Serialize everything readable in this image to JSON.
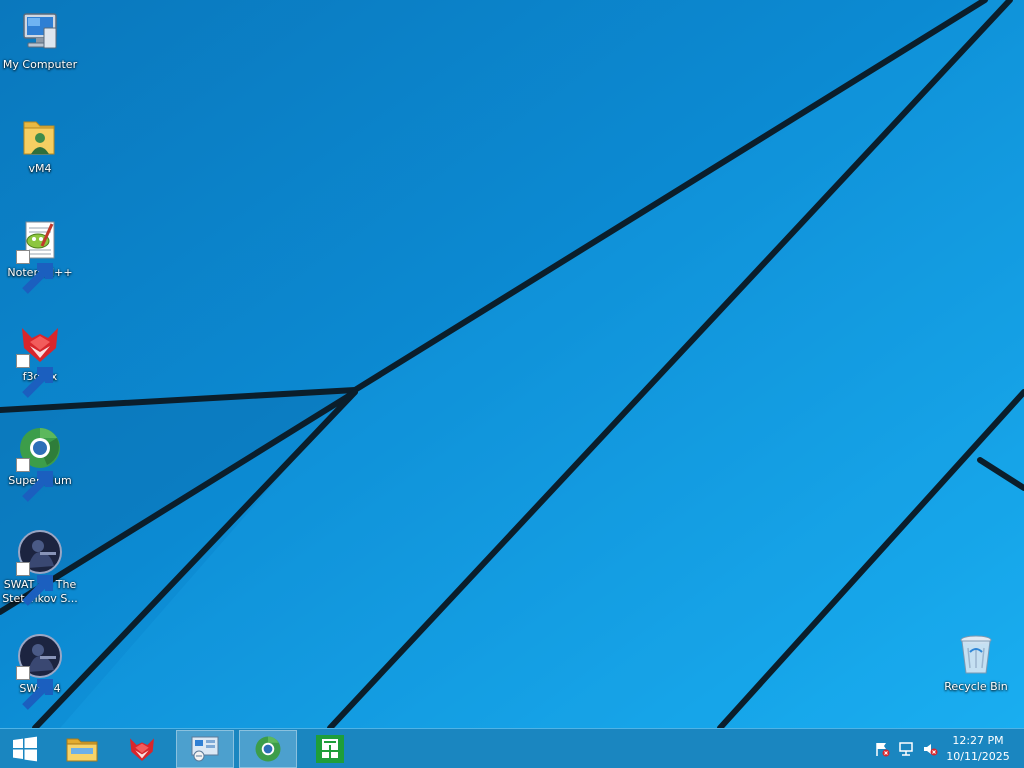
{
  "desktop": {
    "icons": [
      {
        "label": "My Computer",
        "icon": "computer-icon",
        "shortcut": false
      },
      {
        "label": "vM4",
        "icon": "folder-user-icon",
        "shortcut": false
      },
      {
        "label": "Notepad++",
        "icon": "notepadpp-icon",
        "shortcut": true
      },
      {
        "label": "f3dfox",
        "icon": "fox-icon",
        "shortcut": true
      },
      {
        "label": "Supermium",
        "icon": "supermium-icon",
        "shortcut": true
      },
      {
        "label": "SWAT 4 - The Stetchkov S...",
        "icon": "swat4-icon",
        "shortcut": true
      },
      {
        "label": "SWAT 4",
        "icon": "swat4-icon",
        "shortcut": true
      }
    ],
    "recycle_bin": {
      "label": "Recycle Bin",
      "icon": "recycle-bin-icon"
    }
  },
  "taskbar": {
    "start": {
      "icon": "windows-logo-icon"
    },
    "pinned": [
      {
        "icon": "file-explorer-icon",
        "active": false
      },
      {
        "icon": "fox-icon",
        "active": false
      },
      {
        "icon": "control-panel-icon",
        "active": true
      },
      {
        "icon": "supermium-icon",
        "active": true
      },
      {
        "icon": "store-icon",
        "active": false
      }
    ],
    "tray": [
      {
        "icon": "action-center-flag-icon"
      },
      {
        "icon": "network-icon"
      },
      {
        "icon": "volume-muted-icon"
      }
    ],
    "clock": {
      "time": "12:27 PM",
      "date": "10/11/2025"
    }
  },
  "colors": {
    "wallpaper_blue": "#0e8fd6",
    "taskbar": "#1a86c0",
    "store_green": "#1e9e3a"
  }
}
